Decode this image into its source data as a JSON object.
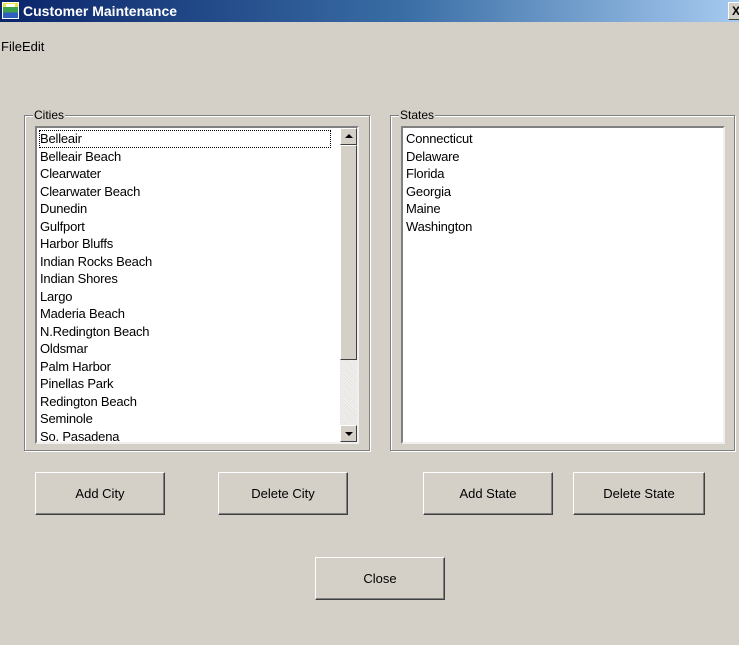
{
  "window": {
    "title": "Customer Maintenance",
    "close_glyph": "X",
    "icon": "app-icon"
  },
  "menu": {
    "items": [
      "File",
      "Edit"
    ]
  },
  "cities": {
    "label": "Cities",
    "items": [
      "Belleair",
      "Belleair Beach",
      "Clearwater",
      "Clearwater Beach",
      "Dunedin",
      "Gulfport",
      "Harbor Bluffs",
      "Indian Rocks Beach",
      "Indian Shores",
      "Largo",
      "Maderia Beach",
      "N.Redington Beach",
      "Oldsmar",
      "Palm Harbor",
      "Pinellas Park",
      "Redington Beach",
      "Seminole",
      "So. Pasadena"
    ],
    "focused_item": "Belleair"
  },
  "states": {
    "label": "States",
    "items": [
      "Connecticut",
      "Delaware",
      "Florida",
      "Georgia",
      "Maine",
      "Washington"
    ]
  },
  "buttons": {
    "add_city": "Add City",
    "delete_city": "Delete City",
    "add_state": "Add State",
    "delete_state": "Delete State",
    "close": "Close"
  },
  "colors": {
    "window_bg": "#d4d0c8",
    "title_bar_start": "#0a246a",
    "title_bar_end": "#a6caf0",
    "list_bg": "#ffffff"
  }
}
